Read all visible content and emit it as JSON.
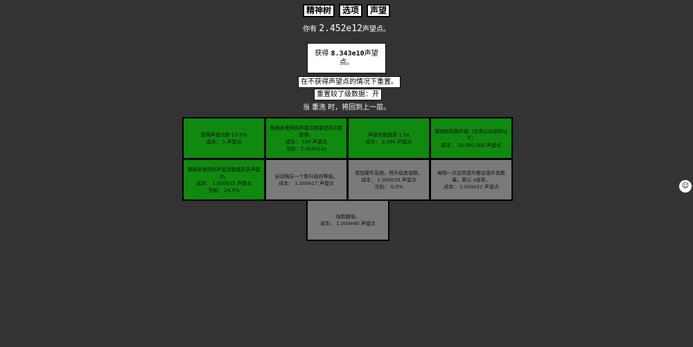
{
  "tabs": [
    {
      "label": "精神树"
    },
    {
      "label": "选项"
    },
    {
      "label": "声望"
    }
  ],
  "points": {
    "prefix": "你有",
    "value": "2.452e12",
    "suffix": "声望点。"
  },
  "reset_box": {
    "prefix": "获得",
    "value": "8.343e10",
    "suffix": "声望点。"
  },
  "reset_without_gain_label": "在不获得声望点的情况下重置。",
  "layer_toggle_label": "重置较了级数据：开",
  "respec_note": "当 重洗 时，将回到上一层。",
  "upgrades": [
    {
      "lines": [
        "获得声望点数 13.5%",
        "成本： 1 声望点"
      ],
      "state": "bought"
    },
    {
      "lines": [
        "根据未使用的声望点数量提高点数获得。",
        "成本： 100 声望点",
        "当前：2.452e12x"
      ],
      "state": "bought"
    },
    {
      "lines": [
        "声望点数提高 1.5x",
        "成本： 2,500 声望点"
      ],
      "state": "bought"
    },
    {
      "lines": [
        "解锁新的数升级（仅有以此级别以下）",
        "成本： 10,000,000 声望点"
      ],
      "state": "bought"
    },
    {
      "lines": [
        "根据未使用的声望点数提高多声望点。",
        "成本： 1.000e15 声望点",
        "当前： 24.0%"
      ],
      "state": "bought"
    },
    {
      "lines": [
        "自动购买一个数升级的等级。",
        "成本： 1.000e17 声望点"
      ],
      "state": "locked"
    },
    {
      "lines": [
        "增加硬件系统，将升级其倍数。",
        "成本： 1.000e20 声望点",
        "当前： 0.0%"
      ],
      "state": "locked"
    },
    {
      "lines": [
        "每购一次这类提升都会提升其数量，乘以 x倍率。",
        "成本： 1.000e22 声望点"
      ],
      "state": "locked"
    }
  ],
  "final_upgrade": {
    "lines": [
      "倍数翻倍。",
      "成本： 1.000e40 声望点"
    ],
    "state": "locked"
  },
  "avatar_glyph": "☺"
}
